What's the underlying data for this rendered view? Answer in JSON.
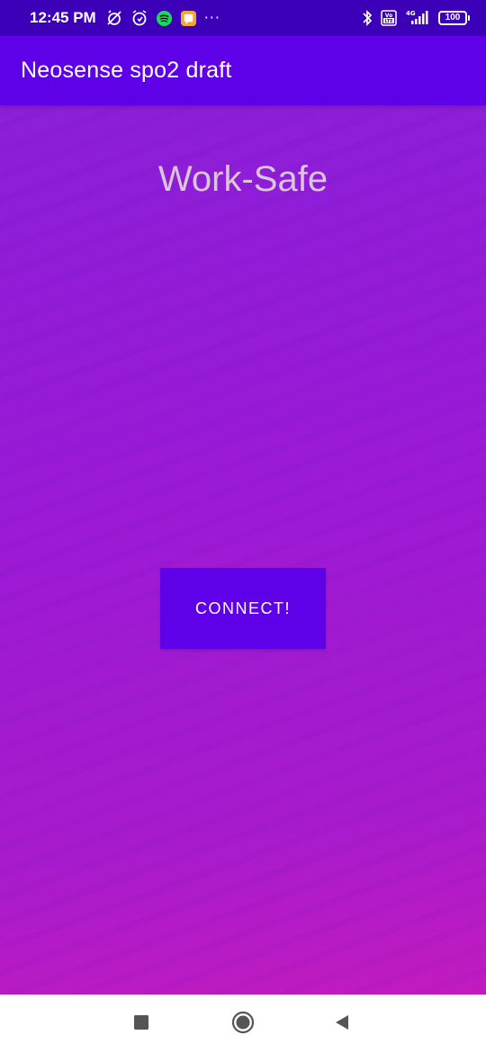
{
  "status_bar": {
    "time": "12:45 PM",
    "network_label": "4G",
    "volte_label": "Vo LTE",
    "battery_level": "100",
    "more_indicator": "···",
    "icons": [
      "muted-alarm-icon",
      "alarm-icon",
      "spotify-icon",
      "notification-app-icon",
      "bluetooth-icon",
      "volte-icon",
      "signal-icon",
      "battery-icon"
    ]
  },
  "app_bar": {
    "title": "Neosense spo2 draft"
  },
  "main": {
    "headline": "Work-Safe",
    "connect_button_label": "CONNECT!"
  },
  "nav_bar": {
    "icons": [
      "recents-icon",
      "home-icon",
      "back-icon"
    ]
  },
  "colors": {
    "status_bar": "#3b00b7",
    "app_bar": "#5e00e8",
    "button": "#5e00e8",
    "gradient_top": "#8b1fd8",
    "gradient_bottom": "#c21bbf",
    "headline_text": "#d9c6d9"
  }
}
